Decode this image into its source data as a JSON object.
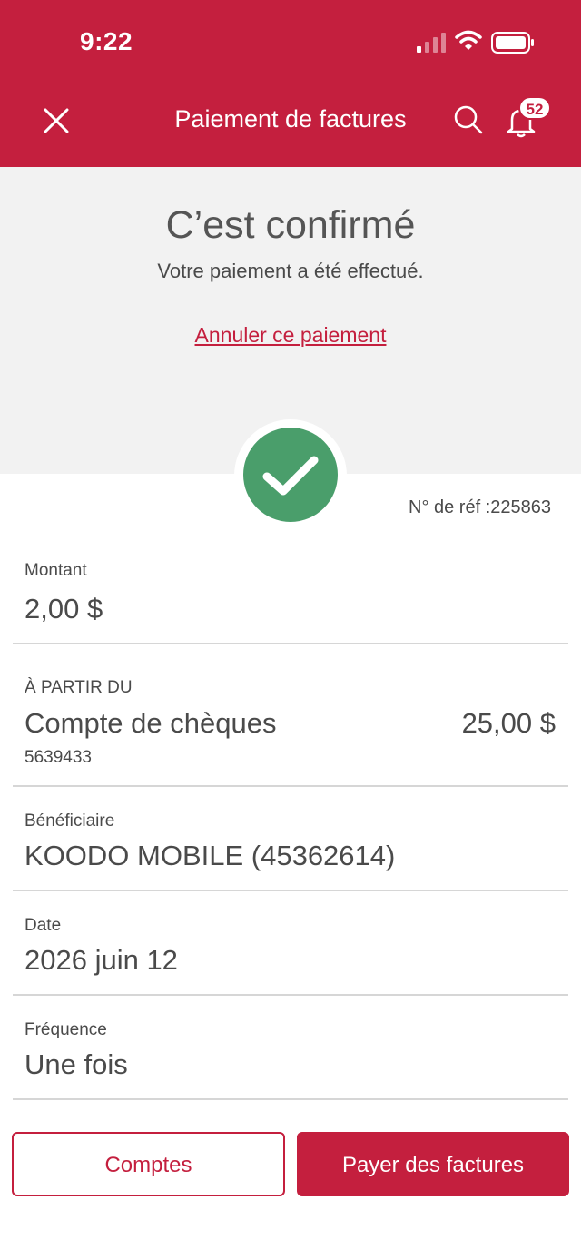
{
  "status_bar": {
    "time": "9:22"
  },
  "nav": {
    "title": "Paiement de factures",
    "notification_count": "52"
  },
  "confirmation": {
    "title": "C’est confirmé",
    "subtitle": "Votre paiement a été effectué.",
    "cancel_link": "Annuler ce paiement",
    "reference": "N° de réf :225863"
  },
  "details": {
    "amount": {
      "label": "Montant",
      "value": "2,00 $"
    },
    "from": {
      "label": "À PARTIR DU",
      "account_name": "Compte de chèques",
      "balance": "25,00 $",
      "account_number": "5639433"
    },
    "payee": {
      "label": "Bénéficiaire",
      "value": "KOODO MOBILE (45362614)"
    },
    "date": {
      "label": "Date",
      "value": "2026 juin 12"
    },
    "frequency": {
      "label": "Fréquence",
      "value": "Une fois"
    }
  },
  "actions": {
    "accounts_label": "Comptes",
    "pay_bills_label": "Payer des factures"
  },
  "colors": {
    "brand": "#c41f3e",
    "success": "#4a9e6b",
    "panel_bg": "#f2f2f2",
    "text": "#4a4a4a",
    "divider": "#d6d6d6"
  }
}
